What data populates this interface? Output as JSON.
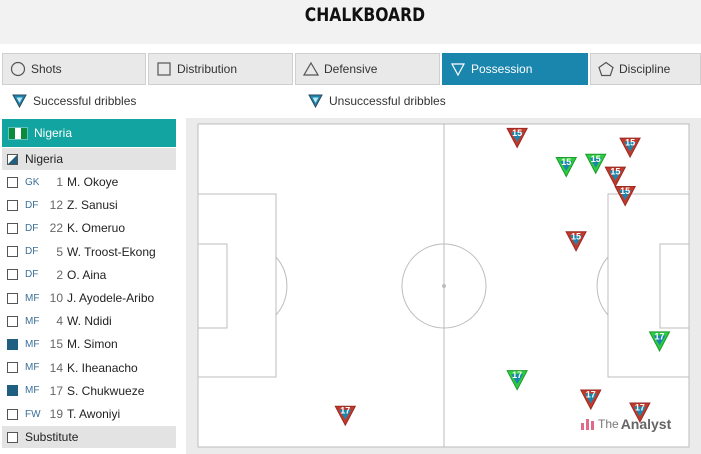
{
  "header": {
    "title": "CHALKBOARD"
  },
  "tabs": [
    {
      "label": "Shots",
      "icon": "circle-icon",
      "active": false
    },
    {
      "label": "Distribution",
      "icon": "square-icon",
      "active": false
    },
    {
      "label": "Defensive",
      "icon": "triangle-icon",
      "active": false
    },
    {
      "label": "Possession",
      "icon": "down-triangle-icon",
      "active": true
    },
    {
      "label": "Discipline",
      "icon": "pentagon-icon",
      "active": false
    }
  ],
  "legend": {
    "successful": "Successful dribbles",
    "unsuccessful": "Unsuccessful dribbles"
  },
  "team": {
    "name": "Nigeria",
    "select_label": "Nigeria"
  },
  "players": [
    {
      "pos": "GK",
      "num": "1",
      "name": "M. Okoye",
      "checked": false
    },
    {
      "pos": "DF",
      "num": "12",
      "name": "Z. Sanusi",
      "checked": false
    },
    {
      "pos": "DF",
      "num": "22",
      "name": "K. Omeruo",
      "checked": false
    },
    {
      "pos": "DF",
      "num": "5",
      "name": "W. Troost-Ekong",
      "checked": false
    },
    {
      "pos": "DF",
      "num": "2",
      "name": "O. Aina",
      "checked": false
    },
    {
      "pos": "MF",
      "num": "10",
      "name": "J. Ayodele-Aribo",
      "checked": false
    },
    {
      "pos": "MF",
      "num": "4",
      "name": "W. Ndidi",
      "checked": false
    },
    {
      "pos": "MF",
      "num": "15",
      "name": "M. Simon",
      "checked": true
    },
    {
      "pos": "MF",
      "num": "14",
      "name": "K. Iheanacho",
      "checked": false
    },
    {
      "pos": "MF",
      "num": "17",
      "name": "S. Chukwueze",
      "checked": true
    },
    {
      "pos": "FW",
      "num": "19",
      "name": "T. Awoniyi",
      "checked": false
    }
  ],
  "substitute_label": "Substitute",
  "colors": {
    "accent": "#1b86ad",
    "team": "#12a4a0",
    "success": "#2ecc40",
    "fail": "#c0392b"
  },
  "events": [
    {
      "player": "15",
      "x": 65,
      "y": 96,
      "success": false
    },
    {
      "player": "15",
      "x": 75,
      "y": 87,
      "success": true
    },
    {
      "player": "15",
      "x": 81,
      "y": 88,
      "success": true
    },
    {
      "player": "15",
      "x": 88,
      "y": 93,
      "success": false
    },
    {
      "player": "15",
      "x": 85,
      "y": 84,
      "success": false
    },
    {
      "player": "15",
      "x": 87,
      "y": 78,
      "success": false
    },
    {
      "player": "15",
      "x": 77,
      "y": 64,
      "success": false
    },
    {
      "player": "17",
      "x": 94,
      "y": 33,
      "success": true
    },
    {
      "player": "17",
      "x": 65,
      "y": 21,
      "success": true
    },
    {
      "player": "17",
      "x": 80,
      "y": 15,
      "success": false
    },
    {
      "player": "17",
      "x": 90,
      "y": 11,
      "success": false
    },
    {
      "player": "17",
      "x": 30,
      "y": 10,
      "success": false
    }
  ],
  "watermark": {
    "prefix": "The",
    "brand": "Analyst"
  }
}
